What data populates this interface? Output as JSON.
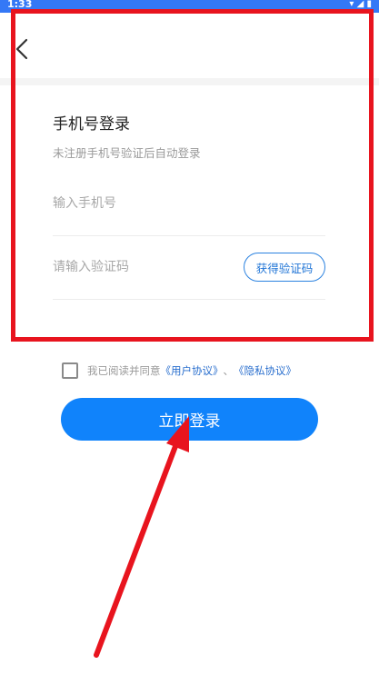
{
  "status_bar": {
    "time": "1:33",
    "icons": "▾ ◢ ▮"
  },
  "header": {
    "back_icon": "chevron-left-icon"
  },
  "login": {
    "title": "手机号登录",
    "subtitle": "未注册手机号验证后自动登录",
    "phone_placeholder": "输入手机号",
    "phone_value": "",
    "code_placeholder": "请输入验证码",
    "code_value": "",
    "get_code_label": "获得验证码"
  },
  "agreement": {
    "prefix": "我已阅读并同意",
    "user_agreement": "《用户协议》",
    "separator": "、",
    "privacy_agreement": "《隐私协议》",
    "checked": false
  },
  "submit": {
    "label": "立即登录"
  },
  "colors": {
    "accent": "#1083fb",
    "link": "#2a6fce",
    "annotation": "#e8141e"
  }
}
